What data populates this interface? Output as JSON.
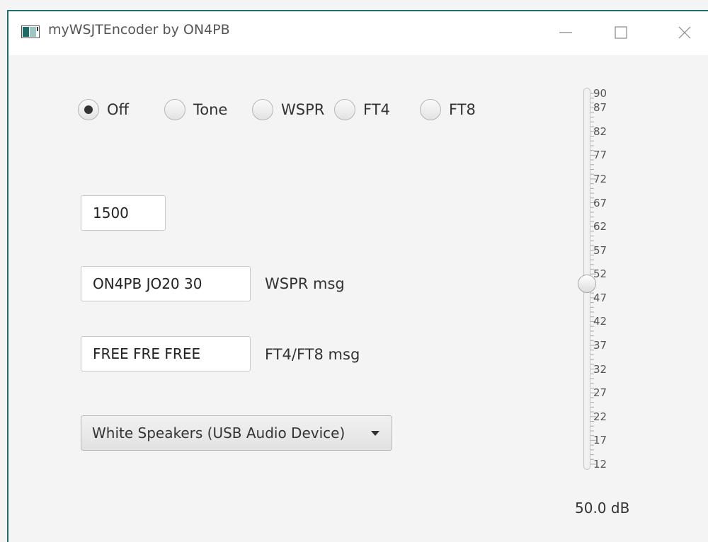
{
  "window": {
    "title": "myWSJTEncoder by ON4PB",
    "controls": [
      "minimize",
      "maximize",
      "close"
    ]
  },
  "mode": {
    "options": [
      "Off",
      "Tone",
      "WSPR",
      "FT4",
      "FT8"
    ],
    "selected": "Off"
  },
  "frequency": {
    "value": "1500"
  },
  "wspr": {
    "value": "ON4PB JO20 30",
    "label": "WSPR msg"
  },
  "ft": {
    "value": "FREE FRE FREE",
    "label": "FT4/FT8 msg"
  },
  "audio_device": {
    "selected": "White Speakers (USB Audio Device)"
  },
  "level_slider": {
    "min": 12,
    "max": 90,
    "value": 50.0,
    "tick_labels": [
      "90",
      "87",
      "82",
      "77",
      "72",
      "67",
      "62",
      "57",
      "52",
      "47",
      "42",
      "37",
      "32",
      "27",
      "22",
      "17",
      "12"
    ],
    "readout": "50.0 dB"
  },
  "colors": {
    "window_border": "#1f6f6a",
    "background": "#f4f4f4",
    "titlebar": "#ffffff"
  }
}
